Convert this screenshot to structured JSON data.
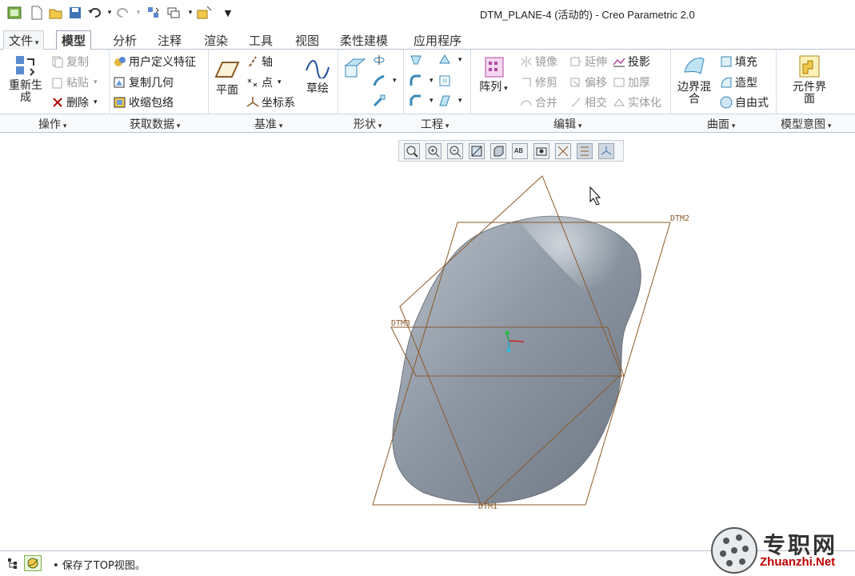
{
  "window": {
    "title": "DTM_PLANE-4 (活动的) - Creo Parametric 2.0"
  },
  "quick_access": [
    "window-icon",
    "new-icon",
    "open-icon",
    "save-icon",
    "undo-icon",
    "redo-icon",
    "regenerate-icon",
    "windows-icon",
    "close-icon",
    "customize-icon"
  ],
  "tabs": [
    "文件",
    "模型",
    "分析",
    "注释",
    "渲染",
    "工具",
    "视图",
    "柔性建模",
    "应用程序"
  ],
  "ribbon": {
    "regen": "重新生成",
    "copy": "复制",
    "paste": "粘贴",
    "delete": "删除",
    "udf": "用户定义特征",
    "copy_geom": "复制几何",
    "shrinkwrap": "收缩包络",
    "plane": "平面",
    "axis": "轴",
    "point": "点",
    "csys": "坐标系",
    "sketch": "草绘",
    "pattern": "阵列",
    "mirror": "镜像",
    "trim": "修剪",
    "merge": "合并",
    "extend": "延伸",
    "offset": "偏移",
    "intersect": "相交",
    "project": "投影",
    "thicken": "加厚",
    "solidify": "实体化",
    "boundary_blend": "边界混合",
    "fill": "填充",
    "style": "造型",
    "freestyle": "自由式",
    "component_interface": "元件界面"
  },
  "groups": [
    "操作",
    "获取数据",
    "基准",
    "形状",
    "工程",
    "编辑",
    "曲面",
    "模型意图"
  ],
  "datums": {
    "dtm1": "DTM1",
    "dtm2": "DTM2",
    "dtm3": "DTM3"
  },
  "status": {
    "message": "• 保存了TOP视图。"
  },
  "watermark": {
    "name": "专职网",
    "url": "Zhuanzhi.Net"
  },
  "colors": {
    "accent": "#2b6cb0",
    "surface": "#8d97a3",
    "datum": "#8a5a2b"
  }
}
